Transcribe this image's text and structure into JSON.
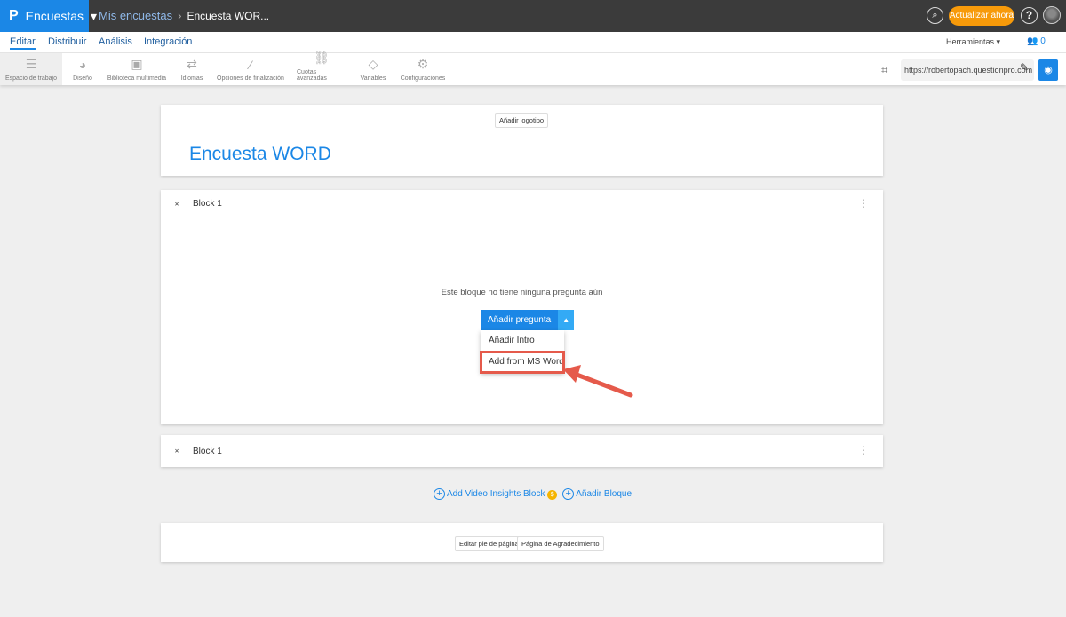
{
  "header": {
    "brand_logo": "P",
    "product": "Encuestas",
    "breadcrumb_root": "Mis encuestas",
    "breadcrumb_current": "Encuesta WOR...",
    "upgrade": "Actualizar ahora",
    "help": "?"
  },
  "nav": {
    "tabs": [
      "Editar",
      "Distribuir",
      "Análisis",
      "Integración"
    ],
    "tools": "Herramientas",
    "users_count": "0"
  },
  "toolbar": {
    "items": [
      "Espacio de trabajo",
      "Diseño",
      "Biblioteca multimedia",
      "Idiomas",
      "Opciones de finalización",
      "Cuotas avanzadas",
      "Variables",
      "Configuraciones"
    ],
    "url": "https://robertopach.questionpro.com"
  },
  "survey": {
    "add_logo": "Añadir logotipo",
    "title": "Encuesta WORD"
  },
  "blocks": [
    {
      "name": "Block 1",
      "empty_text": "Este bloque no tiene ninguna pregunta aún",
      "add_question": "Añadir pregunta",
      "menu": [
        "Añadir Intro",
        "Add from MS Word"
      ]
    },
    {
      "name": "Block 1"
    }
  ],
  "links": {
    "video": "Add Video Insights Block",
    "add_block": "Añadir Bloque"
  },
  "footer": {
    "edit_footer": "Editar pie de página",
    "thanks_page": "Página de Agradecimiento"
  }
}
